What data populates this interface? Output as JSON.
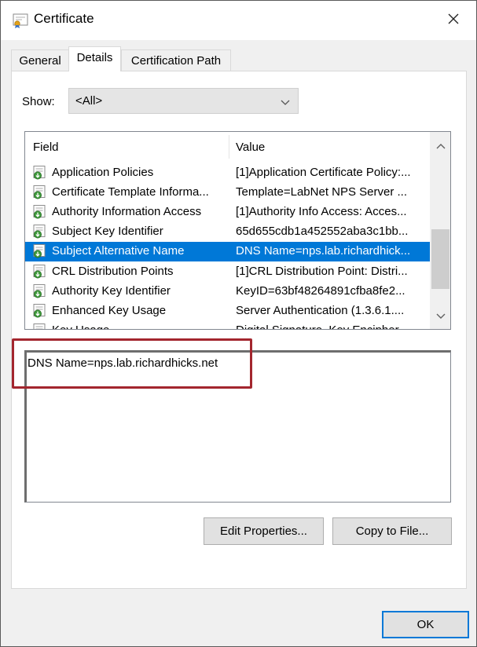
{
  "window": {
    "title": "Certificate"
  },
  "tabs": [
    {
      "label": "General"
    },
    {
      "label": "Details"
    },
    {
      "label": "Certification Path"
    }
  ],
  "show": {
    "label": "Show:",
    "value": "<All>"
  },
  "list": {
    "columns": {
      "field": "Field",
      "value": "Value"
    },
    "rows": [
      {
        "field": "Application Policies",
        "value": "[1]Application Certificate Policy:...",
        "icon": "certificate-field-icon"
      },
      {
        "field": "Certificate Template Informa...",
        "value": "Template=LabNet NPS Server ...",
        "icon": "certificate-field-icon"
      },
      {
        "field": "Authority Information Access",
        "value": "[1]Authority Info Access: Acces...",
        "icon": "certificate-field-icon"
      },
      {
        "field": "Subject Key Identifier",
        "value": "65d655cdb1a452552aba3c1bb...",
        "icon": "certificate-field-icon"
      },
      {
        "field": "Subject Alternative Name",
        "value": "DNS Name=nps.lab.richardhick...",
        "icon": "certificate-field-icon",
        "selected": true
      },
      {
        "field": "CRL Distribution Points",
        "value": "[1]CRL Distribution Point: Distri...",
        "icon": "certificate-field-icon"
      },
      {
        "field": "Authority Key Identifier",
        "value": "KeyID=63bf48264891cfba8fe2...",
        "icon": "certificate-field-icon"
      },
      {
        "field": "Enhanced Key Usage",
        "value": "Server Authentication (1.3.6.1....",
        "icon": "certificate-field-icon"
      },
      {
        "field": "Key Usage",
        "value": "Digital Signature, Key Encipher...",
        "icon": "certificate-field-icon"
      }
    ]
  },
  "detail": {
    "text": "DNS Name=nps.lab.richardhicks.net"
  },
  "buttons": {
    "edit_properties": "Edit Properties...",
    "copy_to_file": "Copy to File...",
    "ok": "OK"
  },
  "colors": {
    "selection": "#0078d7",
    "highlight_border": "#a3262e",
    "default_button_border": "#0078d7"
  }
}
